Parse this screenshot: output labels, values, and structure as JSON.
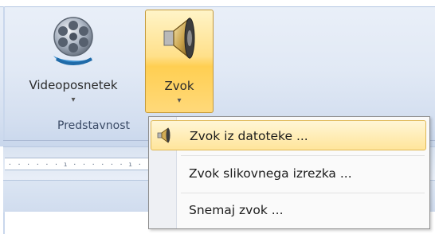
{
  "ribbon": {
    "group_label": "Predstavnost",
    "video_button": {
      "label": "Videoposnetek",
      "arrow": "▾",
      "icon": "film-reel-icon"
    },
    "sound_button": {
      "label": "Zvok",
      "arrow": "▾",
      "icon": "speaker-icon"
    }
  },
  "ruler": {
    "ticks": "· · · · · · ı · · · · · · ı · · · · · ·"
  },
  "dropdown": {
    "items": [
      {
        "label": "Zvok iz datoteke ...",
        "icon": "speaker-small-icon",
        "highlighted": true
      },
      {
        "label": "Zvok slikovnega izrezka ..."
      },
      {
        "label": "Snemaj zvok ..."
      }
    ]
  },
  "colors": {
    "highlight": "#ffe08a",
    "ribbon_bg": "#dfe8f5",
    "menu_border": "#8d8d8d"
  }
}
